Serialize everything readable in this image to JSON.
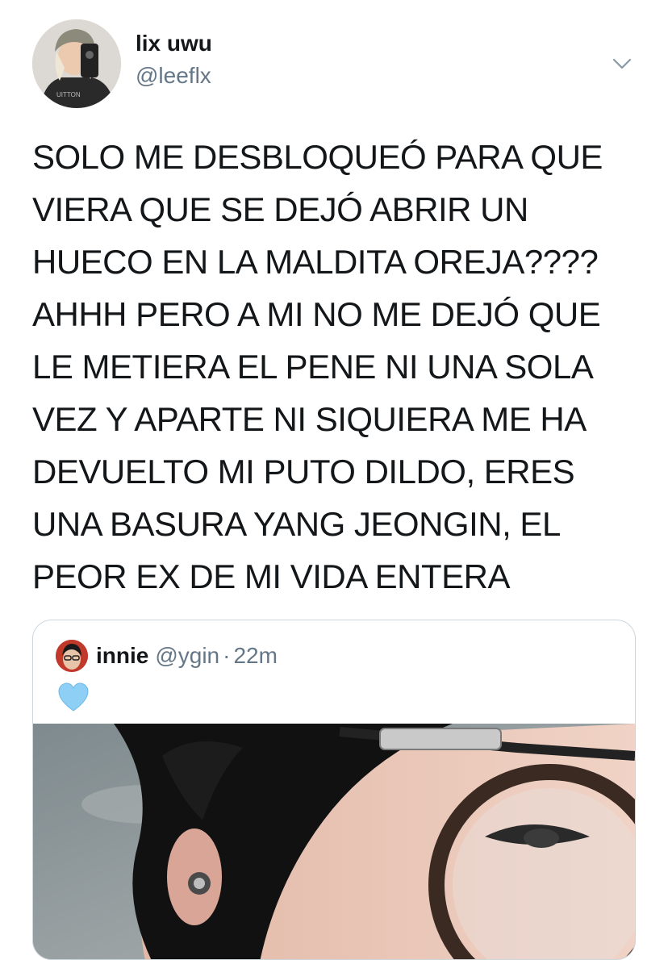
{
  "tweet": {
    "author": {
      "display_name": "lix uwu",
      "handle": "@leeflx"
    },
    "text": "SOLO ME DESBLOQUEÓ PARA QUE\nVIERA QUE SE DEJÓ ABRIR UN\nHUECO EN LA MALDITA OREJA????\nAHHH PERO A MI NO ME DEJÓ QUE\nLE METIERA EL PENE NI UNA SOLA\nVEZ Y APARTE NI SIQUIERA ME HA\nDEVUELTO MI PUTO DILDO, ERES\nUNA BASURA YANG JEONGIN, EL\nPEOR EX DE MI VIDA ENTERA",
    "menu_icon": "chevron-down-icon"
  },
  "quoted_tweet": {
    "display_name": "innie",
    "handle": "@ygin",
    "separator": "·",
    "time": "22m",
    "emoji_name": "blue-heart-icon",
    "emoji_color": "#8ed0f5"
  },
  "avatar_logo_text": "UITTON"
}
